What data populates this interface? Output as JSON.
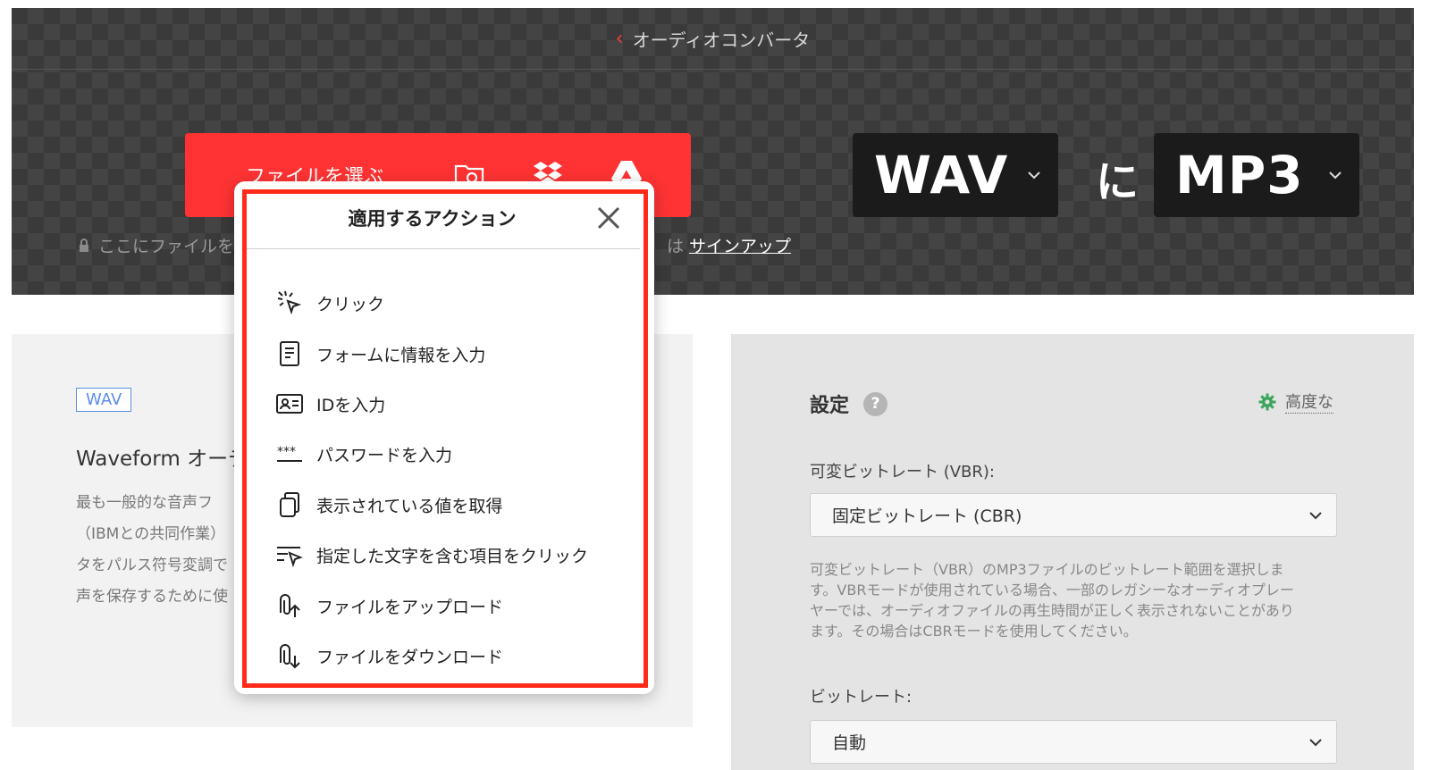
{
  "header": {
    "back_icon": "chevron-left-icon",
    "title": "オーディオコンバータ"
  },
  "upload": {
    "choose_label": "ファイルを選ぶ",
    "drop_hint": "ここにファイルを",
    "signup_prefix": "は",
    "signup_link": "サインアップ"
  },
  "conversion": {
    "from_format": "WAV",
    "connector": "に",
    "to_format": "MP3"
  },
  "info": {
    "badge": "WAV",
    "title": "Waveform オーデ",
    "desc_lines": [
      "最も一般的な音声フ",
      "（IBMとの共同作業）",
      "タをパルス符号変調で",
      "声を保存するために使"
    ]
  },
  "settings": {
    "title": "設定",
    "help_icon": "?",
    "advanced_label": "高度な",
    "vbr_label": "可変ビットレート (VBR):",
    "vbr_value": "固定ビットレート (CBR)",
    "vbr_help": [
      "可変ビットレート（VBR）のMP3ファイルのビットレート範囲を選択しま",
      "す。VBRモードが使用されている場合、一部のレガシーなオーディオプレー",
      "ヤーでは、オーディオファイルの再生時間が正しく表示されないことがあり",
      "ます。その場合はCBRモードを使用してください。"
    ],
    "bitrate_label": "ビットレート:",
    "bitrate_value": "自動"
  },
  "popup": {
    "title": "適用するアクション",
    "actions": [
      {
        "label": "クリック",
        "icon": "click-icon"
      },
      {
        "label": "フォームに情報を入力",
        "icon": "form-icon"
      },
      {
        "label": "IDを入力",
        "icon": "id-card-icon"
      },
      {
        "label": "パスワードを入力",
        "icon": "password-icon"
      },
      {
        "label": "表示されている値を取得",
        "icon": "copy-icon"
      },
      {
        "label": "指定した文字を含む項目をクリック",
        "icon": "text-click-icon"
      },
      {
        "label": "ファイルをアップロード",
        "icon": "upload-icon"
      },
      {
        "label": "ファイルをダウンロード",
        "icon": "download-icon"
      }
    ]
  },
  "colors": {
    "brand_red": "#ff3333",
    "highlight_red": "#ff2a1a",
    "dark_box": "#1b1b1b",
    "badge_blue": "#5b8de8",
    "gear_green": "#3aa55d"
  }
}
